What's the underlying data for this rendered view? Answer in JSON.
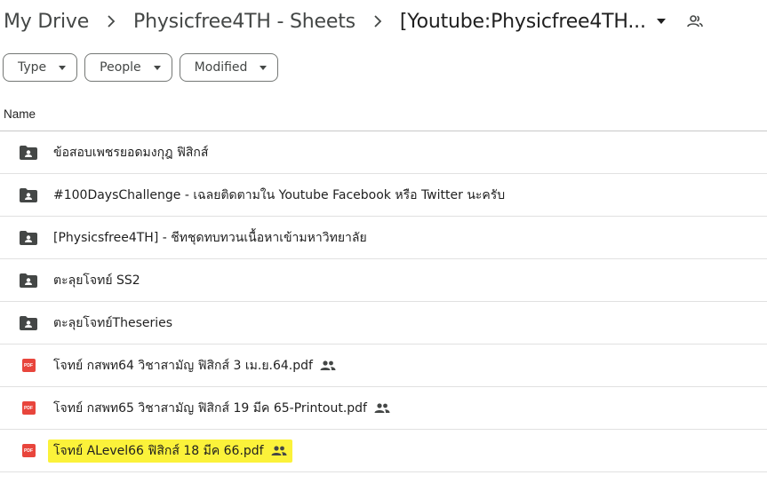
{
  "breadcrumb": {
    "items": [
      "My Drive",
      "Physicfree4TH - Sheets",
      "[Youtube:Physicfree4TH..."
    ]
  },
  "filters": [
    {
      "label": "Type"
    },
    {
      "label": "People"
    },
    {
      "label": "Modified"
    }
  ],
  "list_header": {
    "name_label": "Name"
  },
  "files": [
    {
      "name": "ข้อสอบเพชรยอดมงกุฎ ฟิสิกส์",
      "kind": "shared-folder",
      "icon": "shared-folder-icon",
      "shared": false,
      "highlighted": false
    },
    {
      "name": "#100DaysChallenge - เฉลยติดตามใน Youtube Facebook หรือ Twitter นะครับ",
      "kind": "shared-folder",
      "icon": "shared-folder-icon",
      "shared": false,
      "highlighted": false
    },
    {
      "name": "[Physicsfree4TH] - ชีทชุดทบทวนเนื้อหาเข้ามหาวิทยาลัย",
      "kind": "shared-folder",
      "icon": "shared-folder-icon",
      "shared": false,
      "highlighted": false
    },
    {
      "name": "ตะลุยโจทย์ SS2",
      "kind": "shared-folder",
      "icon": "shared-folder-icon",
      "shared": false,
      "highlighted": false
    },
    {
      "name": "ตะลุยโจทย์Theseries",
      "kind": "shared-folder",
      "icon": "shared-folder-icon",
      "shared": false,
      "highlighted": false
    },
    {
      "name": "โจทย์ กสพท64 วิชาสามัญ ฟิสิกส์ 3 เม.ย.64.pdf",
      "kind": "pdf",
      "icon": "pdf-icon",
      "shared": true,
      "highlighted": false
    },
    {
      "name": "โจทย์ กสพท65 วิชาสามัญ ฟิสิกส์ 19 มีค 65-Printout.pdf",
      "kind": "pdf",
      "icon": "pdf-icon",
      "shared": true,
      "highlighted": false
    },
    {
      "name": "โจทย์ ALevel66 ฟิสิกส์ 18 มีค 66.pdf",
      "kind": "pdf",
      "icon": "pdf-icon",
      "shared": true,
      "highlighted": true
    }
  ],
  "pdf_badge_text": "PDF",
  "colors": {
    "folder_icon": "#444746",
    "pdf_icon": "#e8453c",
    "highlight": "#fbf23a",
    "text": "#1f1f1f"
  }
}
